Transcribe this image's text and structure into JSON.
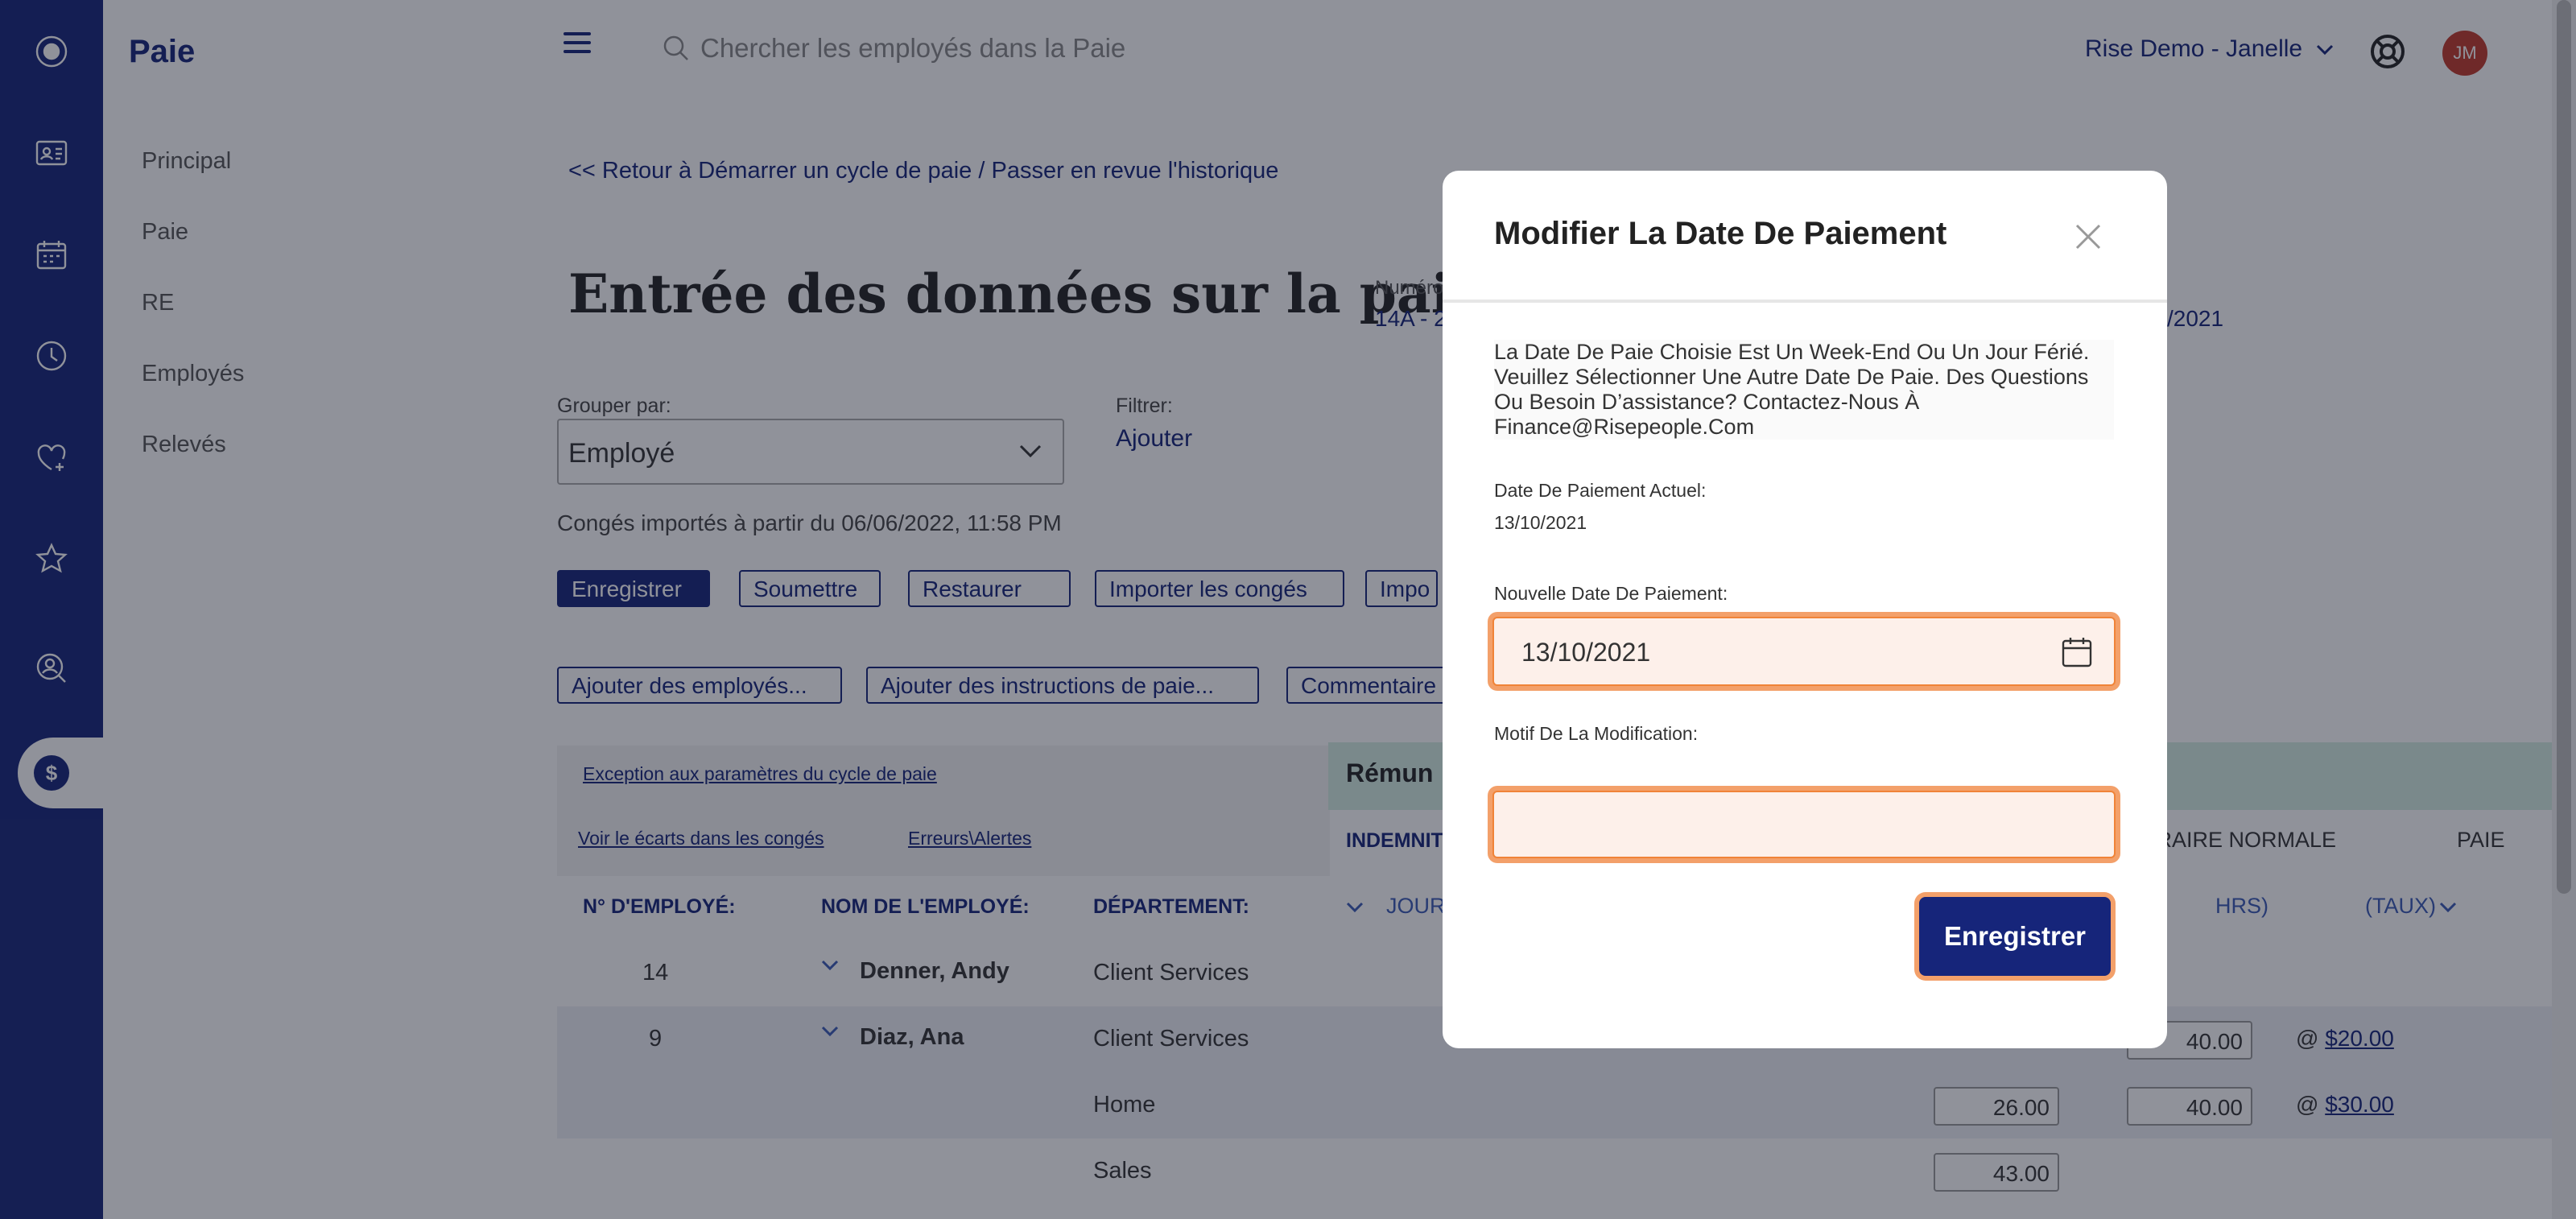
{
  "sidebar": {
    "title": "Paie",
    "items": [
      {
        "label": "Principal"
      },
      {
        "label": "Paie"
      },
      {
        "label": "RE"
      },
      {
        "label": "Employés"
      },
      {
        "label": "Relevés"
      }
    ]
  },
  "topbar": {
    "search_placeholder": "Chercher les employés dans la Paie",
    "account": "Rise Demo - Janelle",
    "avatar_initials": "JM"
  },
  "page": {
    "back_link": "<< Retour à Démarrer un cycle de paie / Passer en revue l'historique",
    "title": "Entrée des données sur la paie",
    "meta_label": "Numéro",
    "meta_value": "14A - 2",
    "meta_date": "/2021",
    "group_label": "Grouper par:",
    "group_value": "Employé",
    "filter_label": "Filtrer:",
    "filter_value": "Ajouter",
    "import_note": "Congés importés à partir du 06/06/2022, 11:58 PM"
  },
  "actions": {
    "save": "Enregistrer",
    "submit": "Soumettre",
    "restore": "Restaurer",
    "import_leave": "Importer les congés",
    "import": "Impo",
    "add_employees": "Ajouter des employés...",
    "add_instructions": "Ajouter des instructions de paie...",
    "comment": "Commentaire"
  },
  "table": {
    "links": {
      "exception": "Exception aux paramètres du cycle de paie",
      "gaps": "Voir le écarts dans les congés",
      "errors": "Erreurs\\Alertes"
    },
    "band_title": "Rémun",
    "headers": {
      "employee_no": "N° D'EMPLOYÉ:",
      "employee_name": "NOM DE L'EMPLOYÉ:",
      "department": "DÉPARTEMENT:",
      "indemnity": "INDEMNIT",
      "normal_hours": "HORAIRE NORMALE",
      "pay": "PAIE",
      "days": "JOUR",
      "hrs": "HRS)",
      "rate": "(TAUX)"
    },
    "rows": [
      {
        "no": "14",
        "name": "Denner, Andy",
        "dept": "Client Services"
      },
      {
        "no": "9",
        "name": "Diaz, Ana",
        "dept": "Client Services",
        "hours": "40.00",
        "rate": "$20.00"
      },
      {
        "dept": "Home",
        "value": "26.00",
        "hours": "40.00",
        "rate": "$30.00"
      },
      {
        "dept": "Sales",
        "value": "43.00"
      }
    ],
    "at_sign": "@"
  },
  "modal": {
    "title": "Modifier La Date De Paiement",
    "message": "La Date De Paie Choisie Est Un Week-End Ou Un Jour Férié. Veuillez Sélectionner Une Autre Date De Paie. Des Questions Ou Besoin D’assistance? Contactez-Nous À Finance@Risepeople.Com",
    "current_label": "Date De Paiement Actuel:",
    "current_value": "13/10/2021",
    "new_label": "Nouvelle Date De Paiement:",
    "new_value": "13/10/2021",
    "reason_label": "Motif De La Modification:",
    "reason_value": "",
    "save": "Enregistrer"
  },
  "colors": {
    "brand": "#16257a",
    "highlight": "#f08338",
    "band": "#d6eee3"
  }
}
